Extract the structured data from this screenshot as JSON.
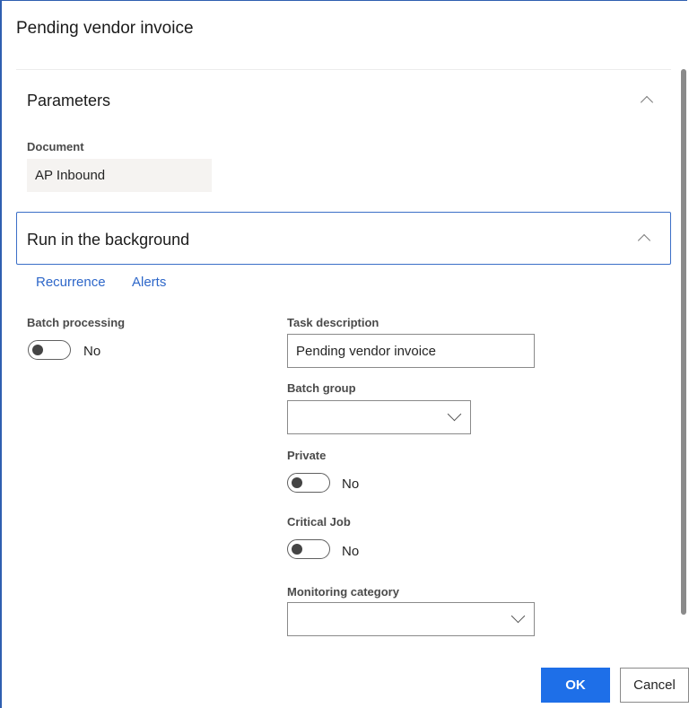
{
  "dialog": {
    "title": "Pending vendor invoice"
  },
  "parameters": {
    "section_title": "Parameters",
    "document_label": "Document",
    "document_value": "AP Inbound"
  },
  "background": {
    "section_title": "Run in the background",
    "links": [
      "Recurrence",
      "Alerts"
    ],
    "batch_processing": {
      "label": "Batch processing",
      "state": "No"
    },
    "task_description": {
      "label": "Task description",
      "value": "Pending vendor invoice"
    },
    "batch_group": {
      "label": "Batch group",
      "value": ""
    },
    "private": {
      "label": "Private",
      "state": "No"
    },
    "critical_job": {
      "label": "Critical Job",
      "state": "No"
    },
    "monitoring_category": {
      "label": "Monitoring category",
      "value": ""
    }
  },
  "footer": {
    "ok_label": "OK",
    "cancel_label": "Cancel"
  },
  "colors": {
    "accent": "#1e6fe8",
    "link": "#2e67c9",
    "focus_border": "#3b6fc7"
  }
}
